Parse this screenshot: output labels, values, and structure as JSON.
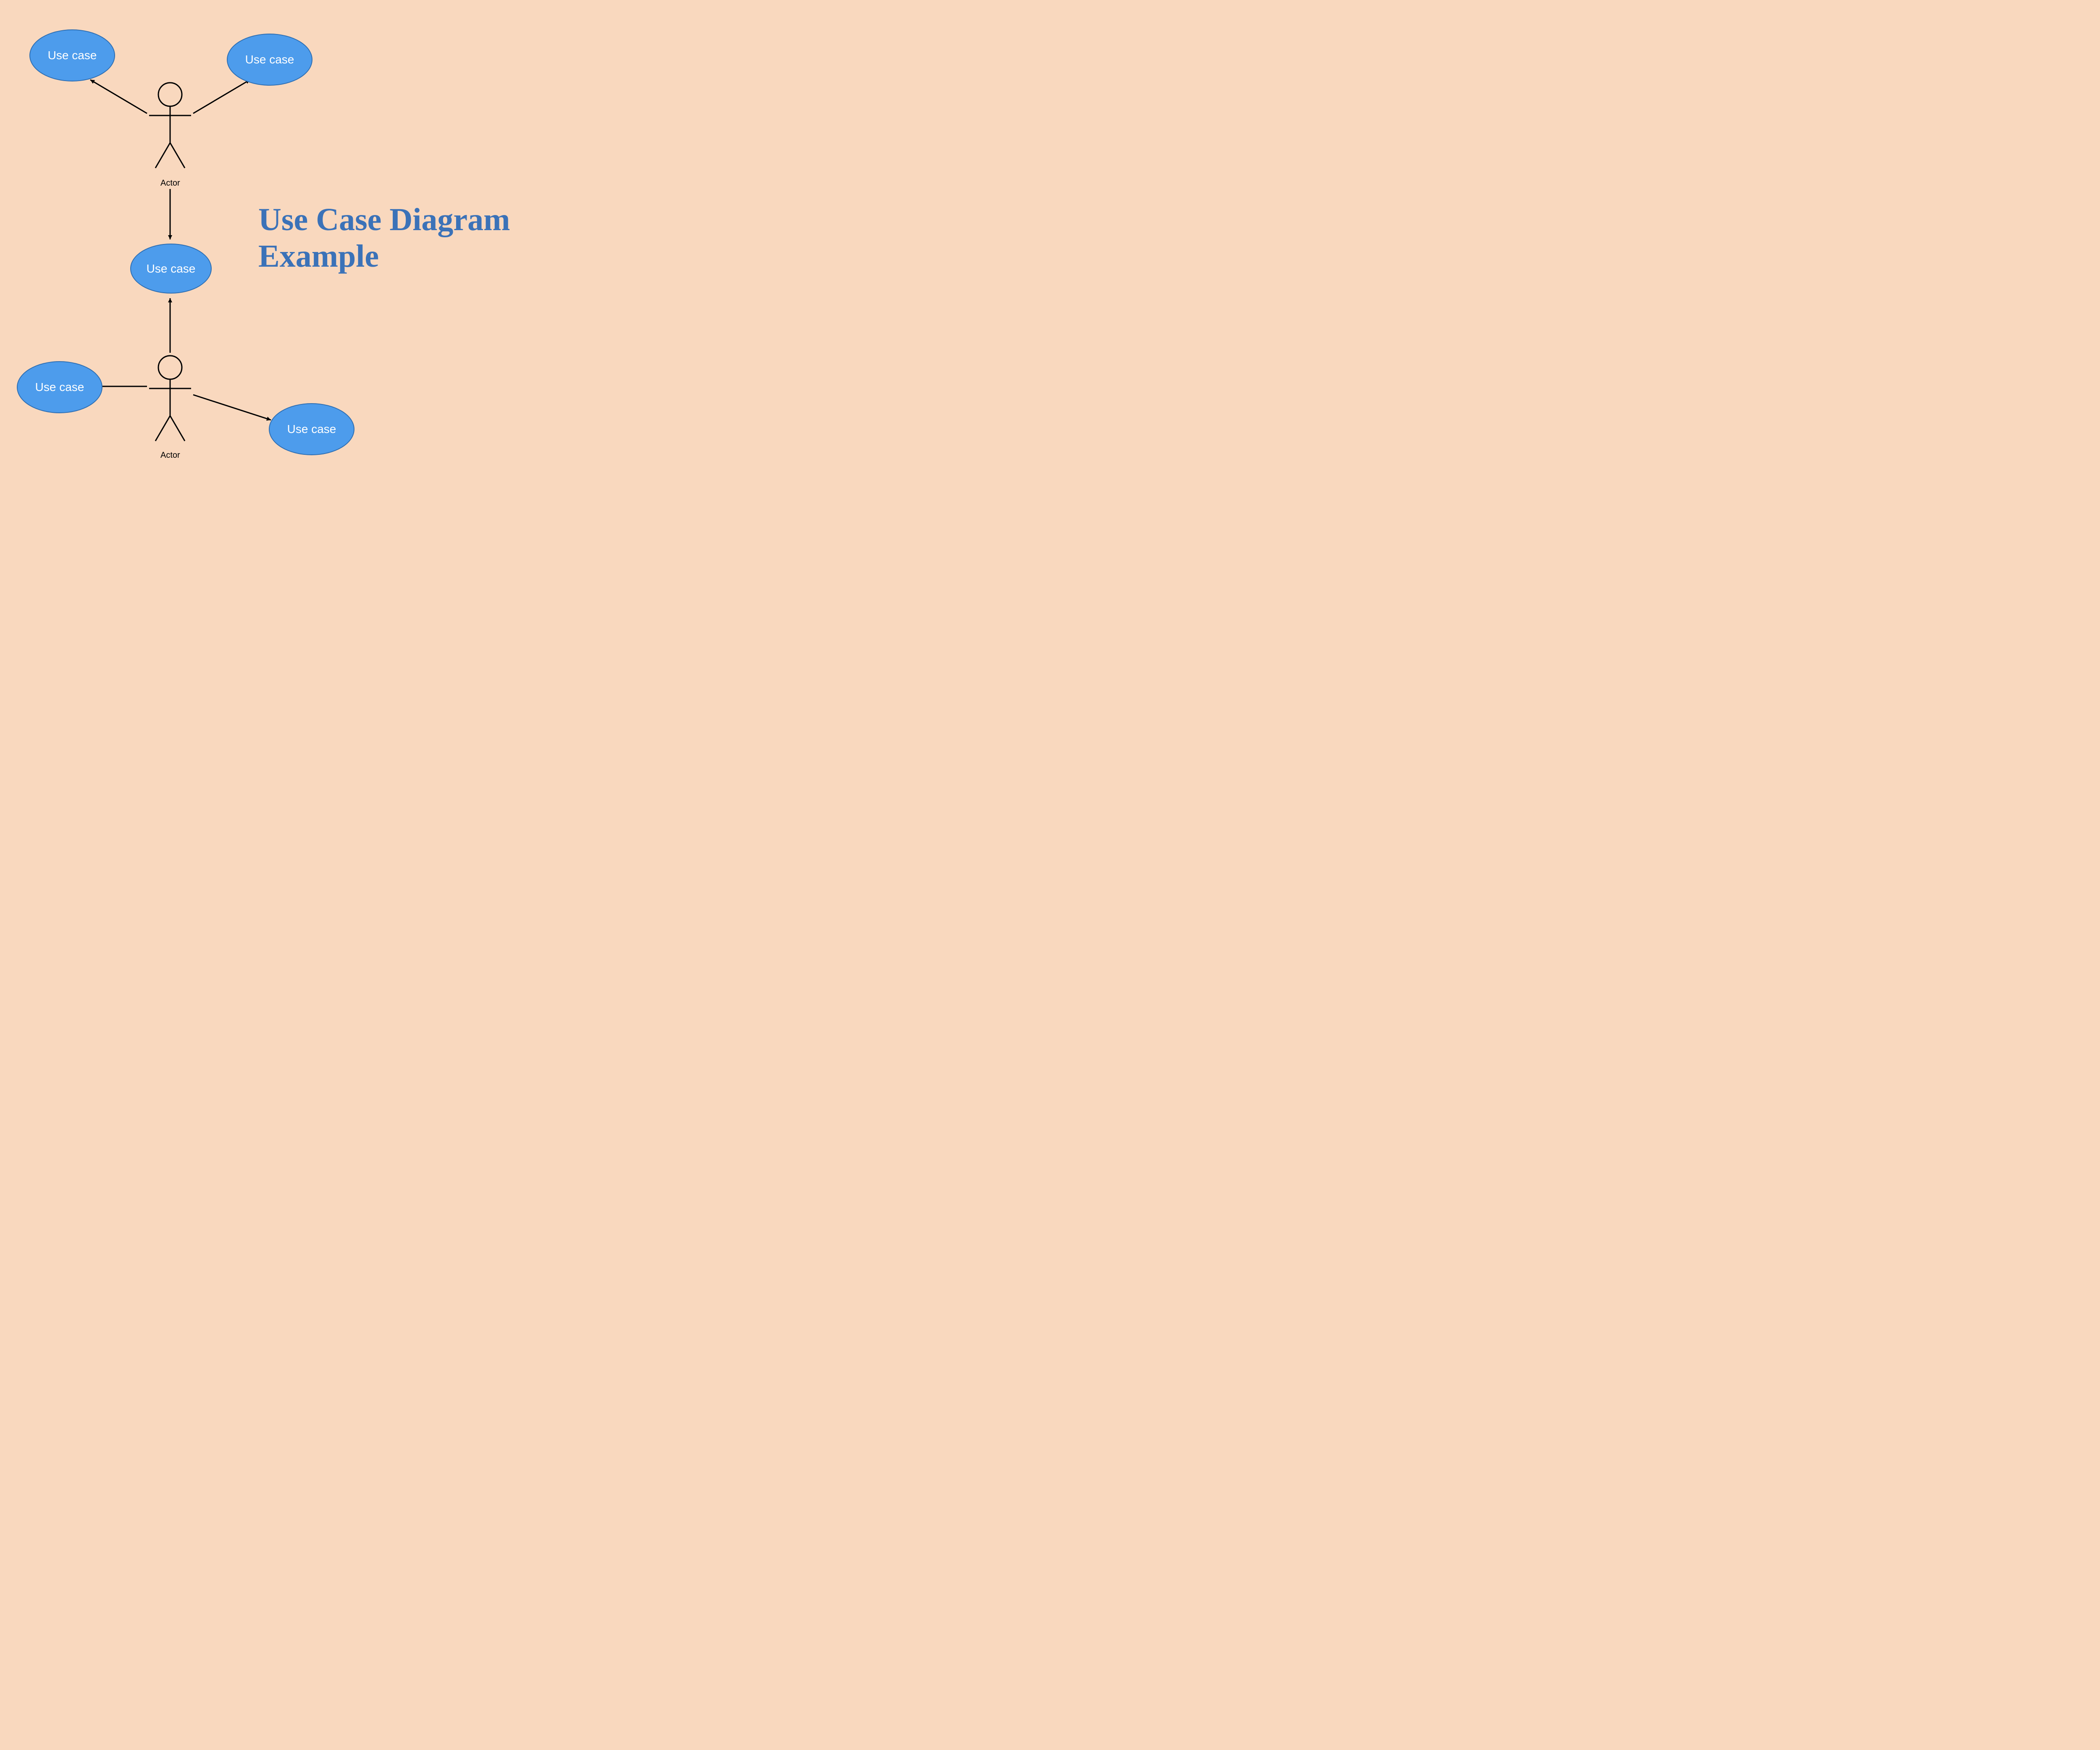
{
  "title": "Use Case Diagram Example",
  "actors": {
    "top": {
      "label": "Actor"
    },
    "bottom": {
      "label": "Actor"
    }
  },
  "usecases": {
    "topLeft": {
      "label": "Use case"
    },
    "topRight": {
      "label": "Use case"
    },
    "middle": {
      "label": "Use case"
    },
    "bottomLeft": {
      "label": "Use case"
    },
    "bottomRight": {
      "label": "Use case"
    }
  },
  "colors": {
    "background": "#f9d8be",
    "usecaseFill": "#4d9cec",
    "usecaseStroke": "#2f6fb3",
    "titleColor": "#3b72b8"
  }
}
